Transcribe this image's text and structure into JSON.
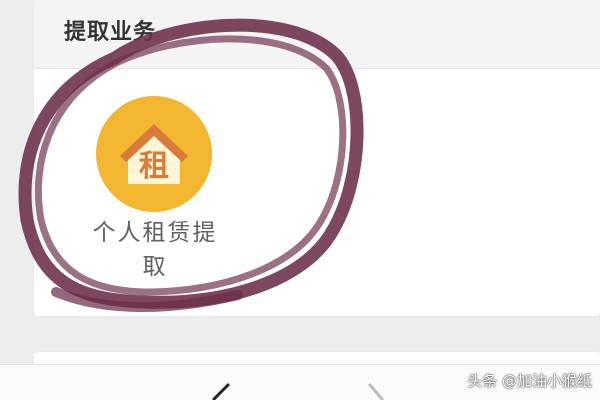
{
  "section": {
    "title": "提取业务"
  },
  "services": [
    {
      "label": "个人租赁提取",
      "icon_text": "租",
      "icon_name": "house-rent-icon",
      "icon_bg_color": "#f2b630",
      "icon_roof_color": "#d97b3a",
      "icon_house_color": "#fff6d8",
      "icon_char_color": "#d97b3a"
    }
  ],
  "navigation": {
    "back_icon": "chevron-left-icon",
    "forward_icon": "chevron-right-icon"
  },
  "watermark": {
    "text": "头条 @加油小猴纸"
  },
  "annotation": {
    "color": "#6b2d49"
  }
}
